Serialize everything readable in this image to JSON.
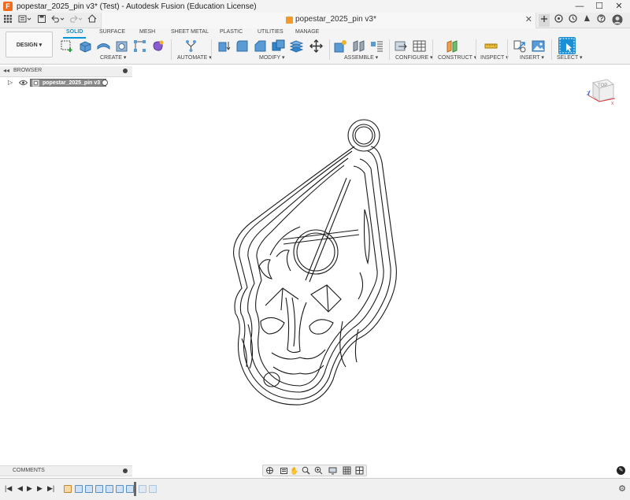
{
  "window": {
    "title": "popestar_2025_pin v3* (Test) - Autodesk Fusion (Education License)",
    "minimize": "—",
    "maximize": "☐",
    "close": "✕"
  },
  "document_tab": {
    "title": "popestar_2025_pin v3*",
    "close": "✕"
  },
  "workspace": {
    "label": "DESIGN ▾"
  },
  "ribbon": {
    "tabs": [
      {
        "label": "SOLID",
        "active": true
      },
      {
        "label": "SURFACE",
        "active": false
      },
      {
        "label": "MESH",
        "active": false
      },
      {
        "label": "SHEET METAL",
        "active": false
      },
      {
        "label": "PLASTIC",
        "active": false
      },
      {
        "label": "UTILITIES",
        "active": false
      },
      {
        "label": "MANAGE",
        "active": false
      }
    ],
    "groups": [
      {
        "label": "CREATE ▾"
      },
      {
        "label": "AUTOMATE ▾"
      },
      {
        "label": "MODIFY ▾"
      },
      {
        "label": "ASSEMBLE ▾"
      },
      {
        "label": "CONFIGURE ▾"
      },
      {
        "label": "CONSTRUCT ▾"
      },
      {
        "label": "INSPECT ▾"
      },
      {
        "label": "INSERT ▾"
      },
      {
        "label": "SELECT ▾"
      }
    ]
  },
  "browser": {
    "label": "BROWSER",
    "root_component": "popestar_2025_pin v3"
  },
  "viewcube": {
    "face": "TOP",
    "axis_x": "X",
    "axis_z": "Z"
  },
  "comments": {
    "label": "COMMENTS"
  },
  "colors": {
    "accent": "#0696d7",
    "fusion_orange": "#f26b1d",
    "document_icon": "#f39a2b"
  }
}
